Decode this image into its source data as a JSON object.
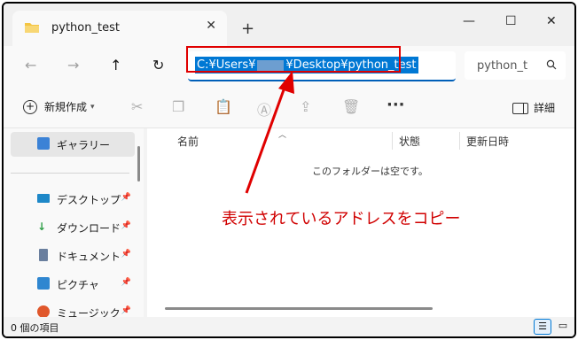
{
  "tab": {
    "title": "python_test",
    "close_glyph": "✕",
    "new_tab_glyph": "+"
  },
  "window_controls": {
    "minimize": "—",
    "maximize": "☐",
    "close": "✕"
  },
  "nav": {
    "back": "←",
    "forward": "→",
    "up": "↑",
    "refresh": "↻"
  },
  "address": {
    "path_prefix": "C:¥Users¥",
    "path_suffix": "¥Desktop¥python_test",
    "clear_glyph": "✕"
  },
  "search": {
    "placeholder": "python_t",
    "icon": "search-icon"
  },
  "toolbar": {
    "new_label": "新規作成",
    "more_glyph": "···",
    "details_label": "詳細"
  },
  "navpane": {
    "items": [
      {
        "label": "ギャラリー",
        "icon": "gallery-icon"
      },
      {
        "label": "デスクトップ",
        "icon": "desktop-icon"
      },
      {
        "label": "ダウンロード",
        "icon": "download-icon"
      },
      {
        "label": "ドキュメント",
        "icon": "document-icon"
      },
      {
        "label": "ピクチャ",
        "icon": "picture-icon"
      },
      {
        "label": "ミュージック",
        "icon": "music-icon"
      }
    ]
  },
  "columns": {
    "name": "名前",
    "status": "状態",
    "modified": "更新日時"
  },
  "content": {
    "empty_message": "このフォルダーは空です。",
    "annotation": "表示されているアドレスをコピー"
  },
  "status_bar": {
    "item_count": "0 個の項目"
  },
  "colors": {
    "accent": "#0078d4",
    "annotation_red": "#e00000"
  }
}
